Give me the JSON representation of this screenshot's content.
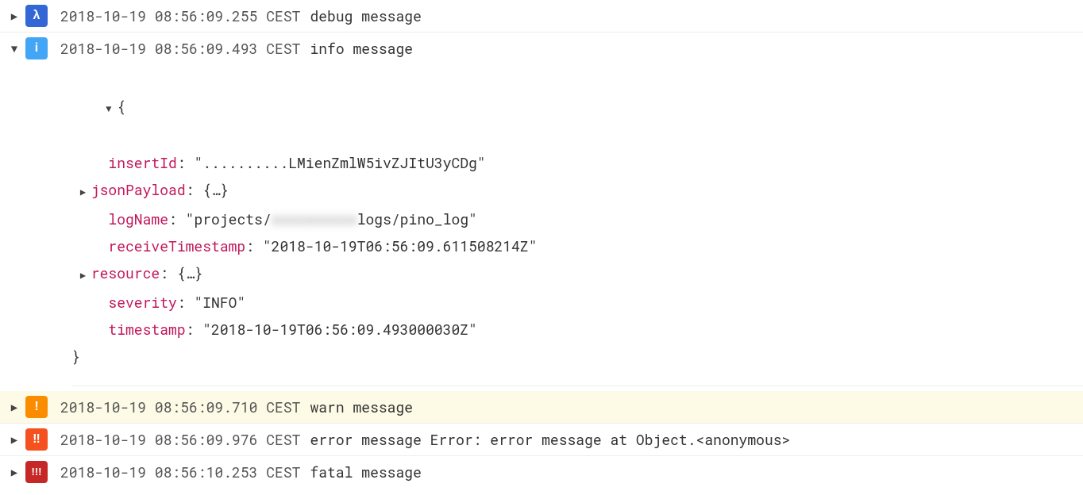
{
  "rows": [
    {
      "expanded": false,
      "severity": "debug",
      "icon": "λ",
      "ts": "2018-10-19 08:56:09.255 CEST",
      "msg": "debug message"
    },
    {
      "expanded": true,
      "severity": "info",
      "icon": "i",
      "ts": "2018-10-19 08:56:09.493 CEST",
      "msg": "info message"
    },
    {
      "expanded": false,
      "severity": "warn",
      "icon": "!",
      "ts": "2018-10-19 08:56:09.710 CEST",
      "msg": "warn message"
    },
    {
      "expanded": false,
      "severity": "error",
      "icon": "‼",
      "ts": "2018-10-19 08:56:09.976 CEST",
      "msg": "error message Error: error message at Object.<anonymous>"
    },
    {
      "expanded": false,
      "severity": "fatal",
      "icon": "!!!",
      "ts": "2018-10-19 08:56:10.253 CEST",
      "msg": "fatal message"
    }
  ],
  "detail": {
    "brace_open": "{",
    "brace_close": "}",
    "insertId_key": "insertId",
    "insertId_val": "\"..........LMienZmlW5ivZJItU3yCDg\"",
    "jsonPayload_key": "jsonPayload",
    "jsonPayload_val": "{…}",
    "logName_key": "logName",
    "logName_prefix": "\"projects/",
    "logName_redacted": "xxxxxxxxxx",
    "logName_suffix": "logs/pino_log\"",
    "receiveTimestamp_key": "receiveTimestamp",
    "receiveTimestamp_val": "\"2018-10-19T06:56:09.611508214Z\"",
    "resource_key": "resource",
    "resource_val": "{…}",
    "severity_key": "severity",
    "severity_val": "\"INFO\"",
    "timestamp_key": "timestamp",
    "timestamp_val": "\"2018-10-19T06:56:09.493000030Z\""
  }
}
